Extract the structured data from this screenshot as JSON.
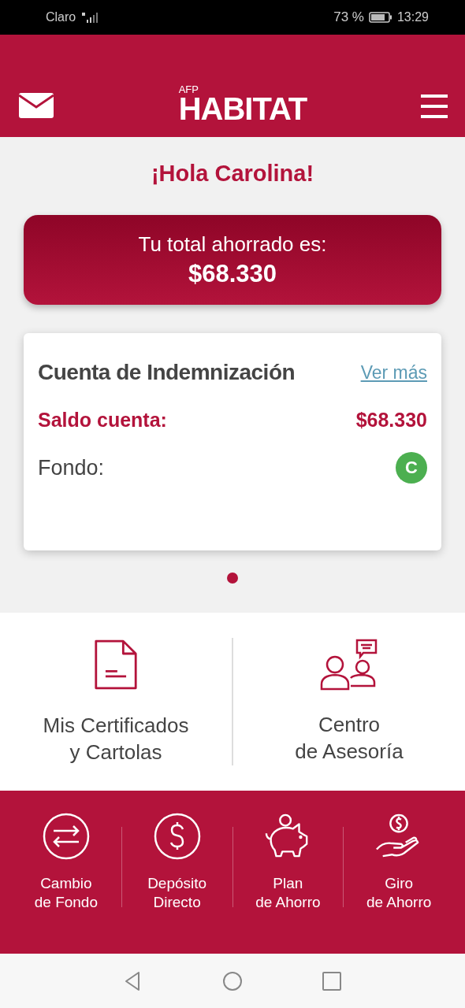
{
  "status_bar": {
    "carrier": "Claro",
    "battery": "73 %",
    "time": "13:29"
  },
  "header": {
    "logo_small": "AFP",
    "logo": "HABITAT"
  },
  "greeting": "¡Hola Carolina!",
  "total": {
    "label": "Tu total ahorrado es:",
    "amount": "$68.330"
  },
  "account_card": {
    "title": "Cuenta de Indemnización",
    "link": "Ver más",
    "balance_label": "Saldo cuenta:",
    "balance": "$68.330",
    "fund_label": "Fondo:",
    "fund": {
      "letter": "C",
      "color": "#4caf50"
    }
  },
  "pager": [
    {
      "selected": true
    }
  ],
  "main_actions": [
    {
      "kind": "document",
      "lines": [
        "Mis Certificados",
        "y Cartolas"
      ]
    },
    {
      "kind": "advisors",
      "lines": [
        "Centro",
        "de Asesoría"
      ]
    }
  ],
  "shortcuts": [
    {
      "kind": "swap",
      "lines": [
        "Cambio",
        "de Fondo"
      ]
    },
    {
      "kind": "dollar",
      "lines": [
        "Depósito",
        "Directo"
      ]
    },
    {
      "kind": "piggy",
      "lines": [
        "Plan",
        "de Ahorro"
      ]
    },
    {
      "kind": "hand",
      "lines": [
        "Giro",
        "de Ahorro"
      ]
    }
  ]
}
